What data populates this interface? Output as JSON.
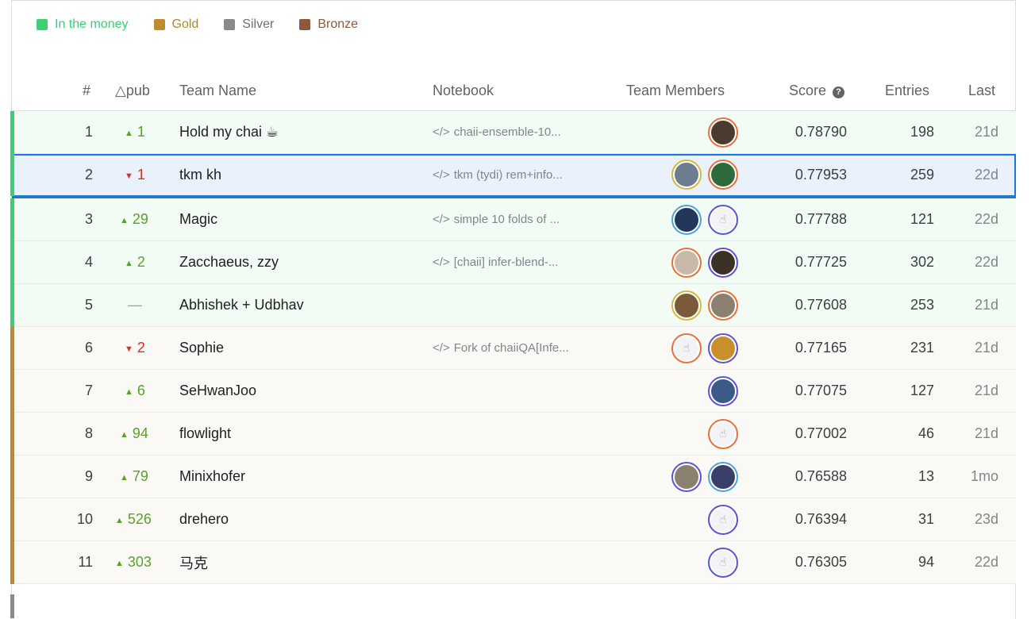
{
  "legend": [
    {
      "label": "In the money",
      "color": "#3ccf74",
      "text_color": "#3ccf74"
    },
    {
      "label": "Gold",
      "color": "#c08a2e",
      "text_color": "#b8862c"
    },
    {
      "label": "Silver",
      "color": "#8a8a8a",
      "text_color": "#6f6f6f"
    },
    {
      "label": "Bronze",
      "color": "#8b5a3c",
      "text_color": "#8b5a3c"
    }
  ],
  "columns": {
    "rank": "#",
    "delta": "△pub",
    "team": "Team Name",
    "notebook": "Notebook",
    "members": "Team Members",
    "score": "Score",
    "entries": "Entries",
    "last": "Last"
  },
  "notebook_prefix": "</>",
  "rows": [
    {
      "rank": "1",
      "dir": "up",
      "delta": "1",
      "team": "Hold my chai ☕",
      "notebook": "chaii-ensemble-10...",
      "avatars": [
        {
          "ring": "orange",
          "face": "photo1"
        }
      ],
      "score": "0.78790",
      "entries": "198",
      "last": "21d",
      "tier": "money"
    },
    {
      "rank": "2",
      "dir": "down",
      "delta": "1",
      "team": "tkm kh",
      "notebook": "tkm (tydi) rem+info...",
      "avatars": [
        {
          "ring": "gold",
          "face": "photo2"
        },
        {
          "ring": "orange",
          "face": "photo3"
        }
      ],
      "score": "0.77953",
      "entries": "259",
      "last": "22d",
      "tier": "money",
      "selected": true
    },
    {
      "rank": "3",
      "dir": "up",
      "delta": "29",
      "team": "Magic",
      "notebook": "simple 10 folds of ...",
      "avatars": [
        {
          "ring": "blue",
          "face": "photo4"
        },
        {
          "ring": "purple",
          "face": "default"
        }
      ],
      "score": "0.77788",
      "entries": "121",
      "last": "22d",
      "tier": "money"
    },
    {
      "rank": "4",
      "dir": "up",
      "delta": "2",
      "team": "Zacchaeus, zzy",
      "notebook": "[chaii] infer-blend-...",
      "avatars": [
        {
          "ring": "orange",
          "face": "photo5"
        },
        {
          "ring": "purple",
          "face": "photo6"
        }
      ],
      "score": "0.77725",
      "entries": "302",
      "last": "22d",
      "tier": "money"
    },
    {
      "rank": "5",
      "dir": "none",
      "delta": "—",
      "team": "Abhishek + Udbhav",
      "notebook": "",
      "avatars": [
        {
          "ring": "gold",
          "face": "photo7"
        },
        {
          "ring": "orange",
          "face": "photo10"
        }
      ],
      "score": "0.77608",
      "entries": "253",
      "last": "21d",
      "tier": "money"
    },
    {
      "rank": "6",
      "dir": "down",
      "delta": "2",
      "team": "Sophie",
      "notebook": "Fork of chaiiQA[Infe...",
      "avatars": [
        {
          "ring": "orange",
          "face": "default"
        },
        {
          "ring": "purple",
          "face": "photo8"
        }
      ],
      "score": "0.77165",
      "entries": "231",
      "last": "21d",
      "tier": "gold"
    },
    {
      "rank": "7",
      "dir": "up",
      "delta": "6",
      "team": "SeHwanJoo",
      "notebook": "",
      "avatars": [
        {
          "ring": "purple",
          "face": "photo9"
        }
      ],
      "score": "0.77075",
      "entries": "127",
      "last": "21d",
      "tier": "gold"
    },
    {
      "rank": "8",
      "dir": "up",
      "delta": "94",
      "team": "flowlight",
      "notebook": "",
      "avatars": [
        {
          "ring": "orange",
          "face": "default"
        }
      ],
      "score": "0.77002",
      "entries": "46",
      "last": "21d",
      "tier": "gold"
    },
    {
      "rank": "9",
      "dir": "up",
      "delta": "79",
      "team": "Minixhofer",
      "notebook": "",
      "avatars": [
        {
          "ring": "purple",
          "face": "photo10"
        },
        {
          "ring": "blue",
          "face": "photo11"
        }
      ],
      "score": "0.76588",
      "entries": "13",
      "last": "1mo",
      "tier": "gold"
    },
    {
      "rank": "10",
      "dir": "up",
      "delta": "526",
      "team": "drehero",
      "notebook": "",
      "avatars": [
        {
          "ring": "purple",
          "face": "default"
        }
      ],
      "score": "0.76394",
      "entries": "31",
      "last": "23d",
      "tier": "gold"
    },
    {
      "rank": "11",
      "dir": "up",
      "delta": "303",
      "team": "马克",
      "notebook": "",
      "avatars": [
        {
          "ring": "purple",
          "face": "default"
        }
      ],
      "score": "0.76305",
      "entries": "94",
      "last": "22d",
      "tier": "gold"
    }
  ],
  "tier_colors": {
    "money": "#3ccf74",
    "gold": "#c08a2e",
    "silver": "#8a8a8a"
  }
}
